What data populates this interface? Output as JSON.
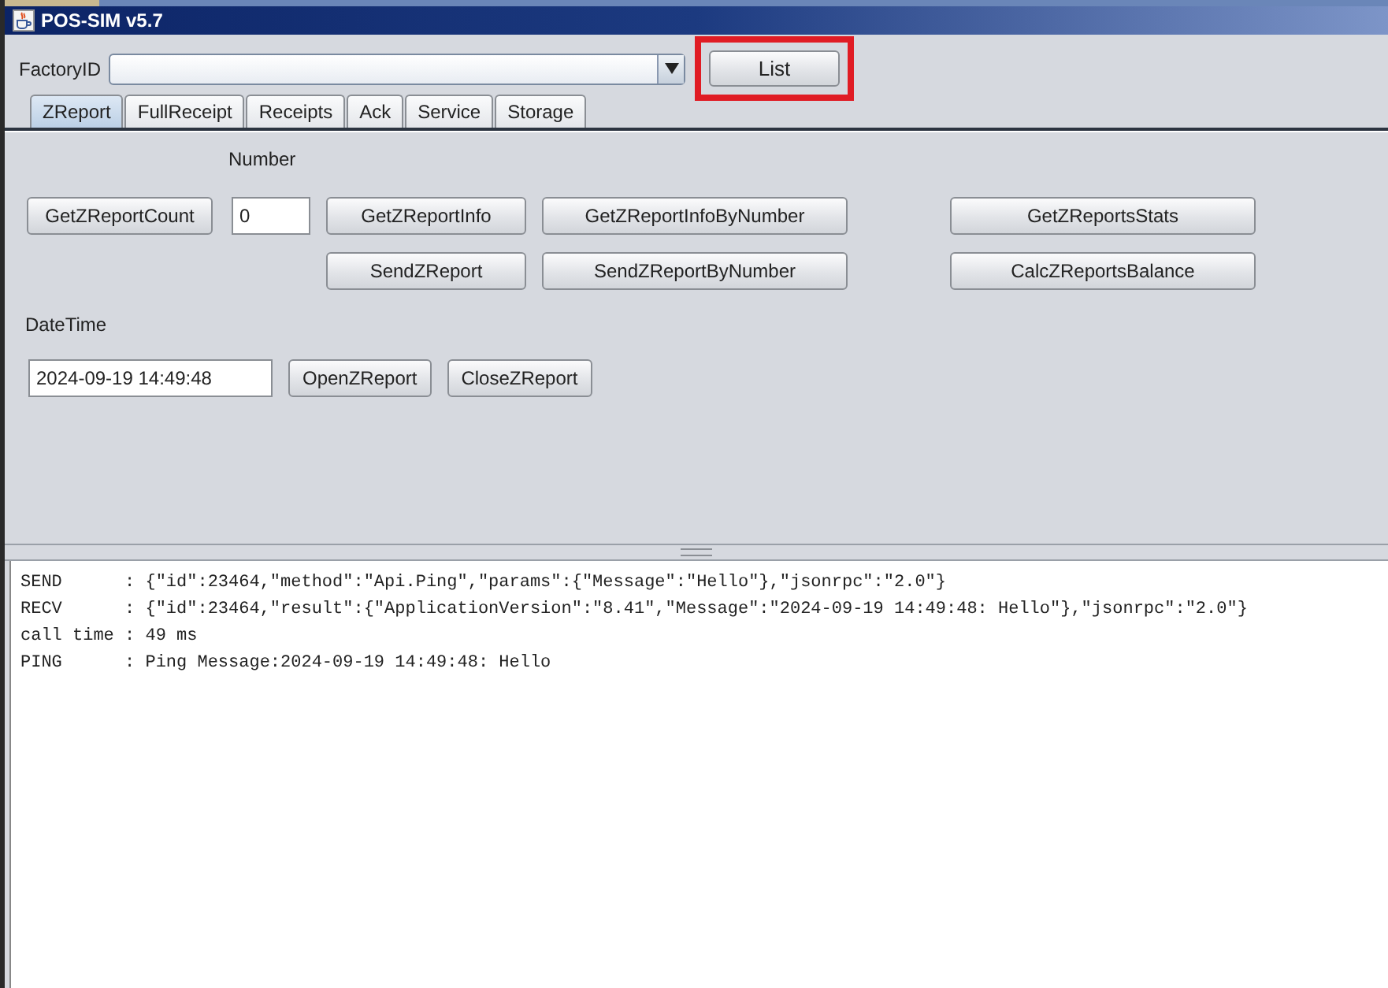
{
  "window": {
    "title": "POS-SIM v5.7"
  },
  "factory": {
    "label": "FactoryID"
  },
  "list_button": {
    "label": "List",
    "highlighted": true
  },
  "tabs": [
    {
      "label": "ZReport",
      "selected": true
    },
    {
      "label": "FullReceipt",
      "selected": false
    },
    {
      "label": "Receipts",
      "selected": false
    },
    {
      "label": "Ack",
      "selected": false
    },
    {
      "label": "Service",
      "selected": false
    },
    {
      "label": "Storage",
      "selected": false
    }
  ],
  "zreport": {
    "count_button": "GetZReportCount",
    "number_label": "Number",
    "number_value": "0",
    "button_rows": [
      [
        "GetZReportInfo",
        "GetZReportInfoByNumber",
        "GetZReportsStats"
      ],
      [
        "SendZReport",
        "SendZReportByNumber",
        "CalcZReportsBalance"
      ]
    ],
    "datetime_label": "DateTime",
    "datetime_value": "2024-09-19 14:49:48",
    "datetime_buttons": [
      "OpenZReport",
      "CloseZReport"
    ]
  },
  "log": [
    "SEND      : {\"id\":23464,\"method\":\"Api.Ping\",\"params\":{\"Message\":\"Hello\"},\"jsonrpc\":\"2.0\"}",
    "RECV      : {\"id\":23464,\"result\":{\"ApplicationVersion\":\"8.41\",\"Message\":\"2024-09-19 14:49:48: Hello\"},\"jsonrpc\":\"2.0\"}",
    "call time : 49 ms",
    "PING      : Ping Message:2024-09-19 14:49:48: Hello"
  ]
}
